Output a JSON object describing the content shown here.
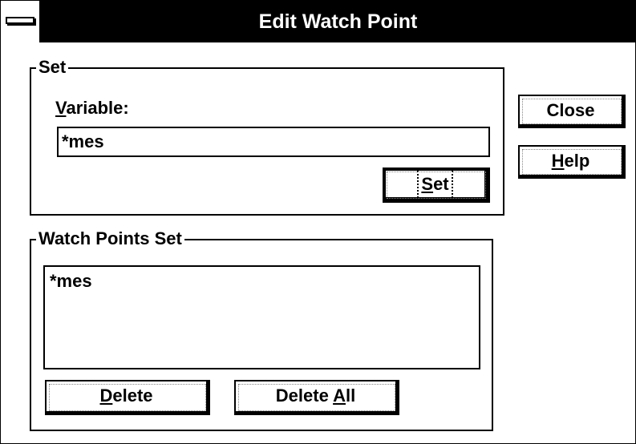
{
  "window": {
    "title": "Edit Watch Point"
  },
  "set_group": {
    "label": "Set",
    "variable_label_first": "V",
    "variable_label_rest": "ariable:",
    "variable_value": "*mes",
    "set_button_first": "S",
    "set_button_rest": "et"
  },
  "watch_group": {
    "label": "Watch Points Set",
    "items": [
      "*mes"
    ],
    "delete_first": "D",
    "delete_rest": "elete",
    "delete_all_prefix": "Delete ",
    "delete_all_accel": "A",
    "delete_all_rest": "ll"
  },
  "side_buttons": {
    "close": "Close",
    "help_first": "H",
    "help_rest": "elp"
  }
}
